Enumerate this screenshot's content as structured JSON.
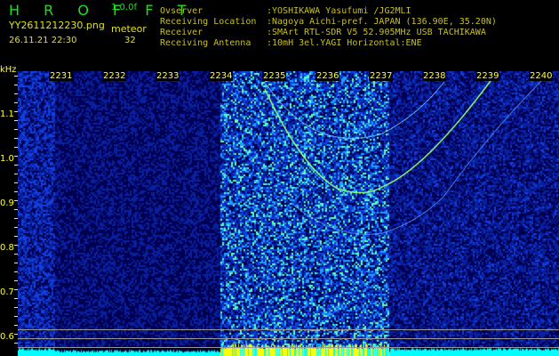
{
  "header": {
    "app_title": "H R O F F T",
    "version": "1.0.0f",
    "filename": "YY2611212230.png",
    "datetime": "26.11.21 22:30",
    "meteor_label": "meteor",
    "meteor_count": "32"
  },
  "info": [
    {
      "label": "Ovserver",
      "value": ":YOSHIKAWA Yasufumi /JG2MLI"
    },
    {
      "label": "Receiving Location",
      "value": ":Nagoya Aichi-pref. JAPAN (136.90E, 35.20N)"
    },
    {
      "label": "Receiver",
      "value": ":SMArt RTL-SDR V5 52.905MHz USB TACHIKAWA"
    },
    {
      "label": "Receiving Antenna",
      "value": ":10mH 3el.YAGI Horizontal:ENE"
    }
  ],
  "spectrogram": {
    "y_unit": "kHz",
    "y_ticks": [
      "1.1",
      "1.0",
      "0.9",
      "0.8",
      "0.7",
      "0.6"
    ],
    "x_ticks": [
      "2231",
      "2232",
      "2233",
      "2234",
      "2235",
      "2236",
      "2237",
      "2238",
      "2239",
      "2240"
    ],
    "colors": {
      "noise_low": "#000040",
      "noise_high": "#2060ff",
      "trail": "#80ff80",
      "bar": "#00ffff",
      "bar_active": "#ffff00"
    }
  }
}
